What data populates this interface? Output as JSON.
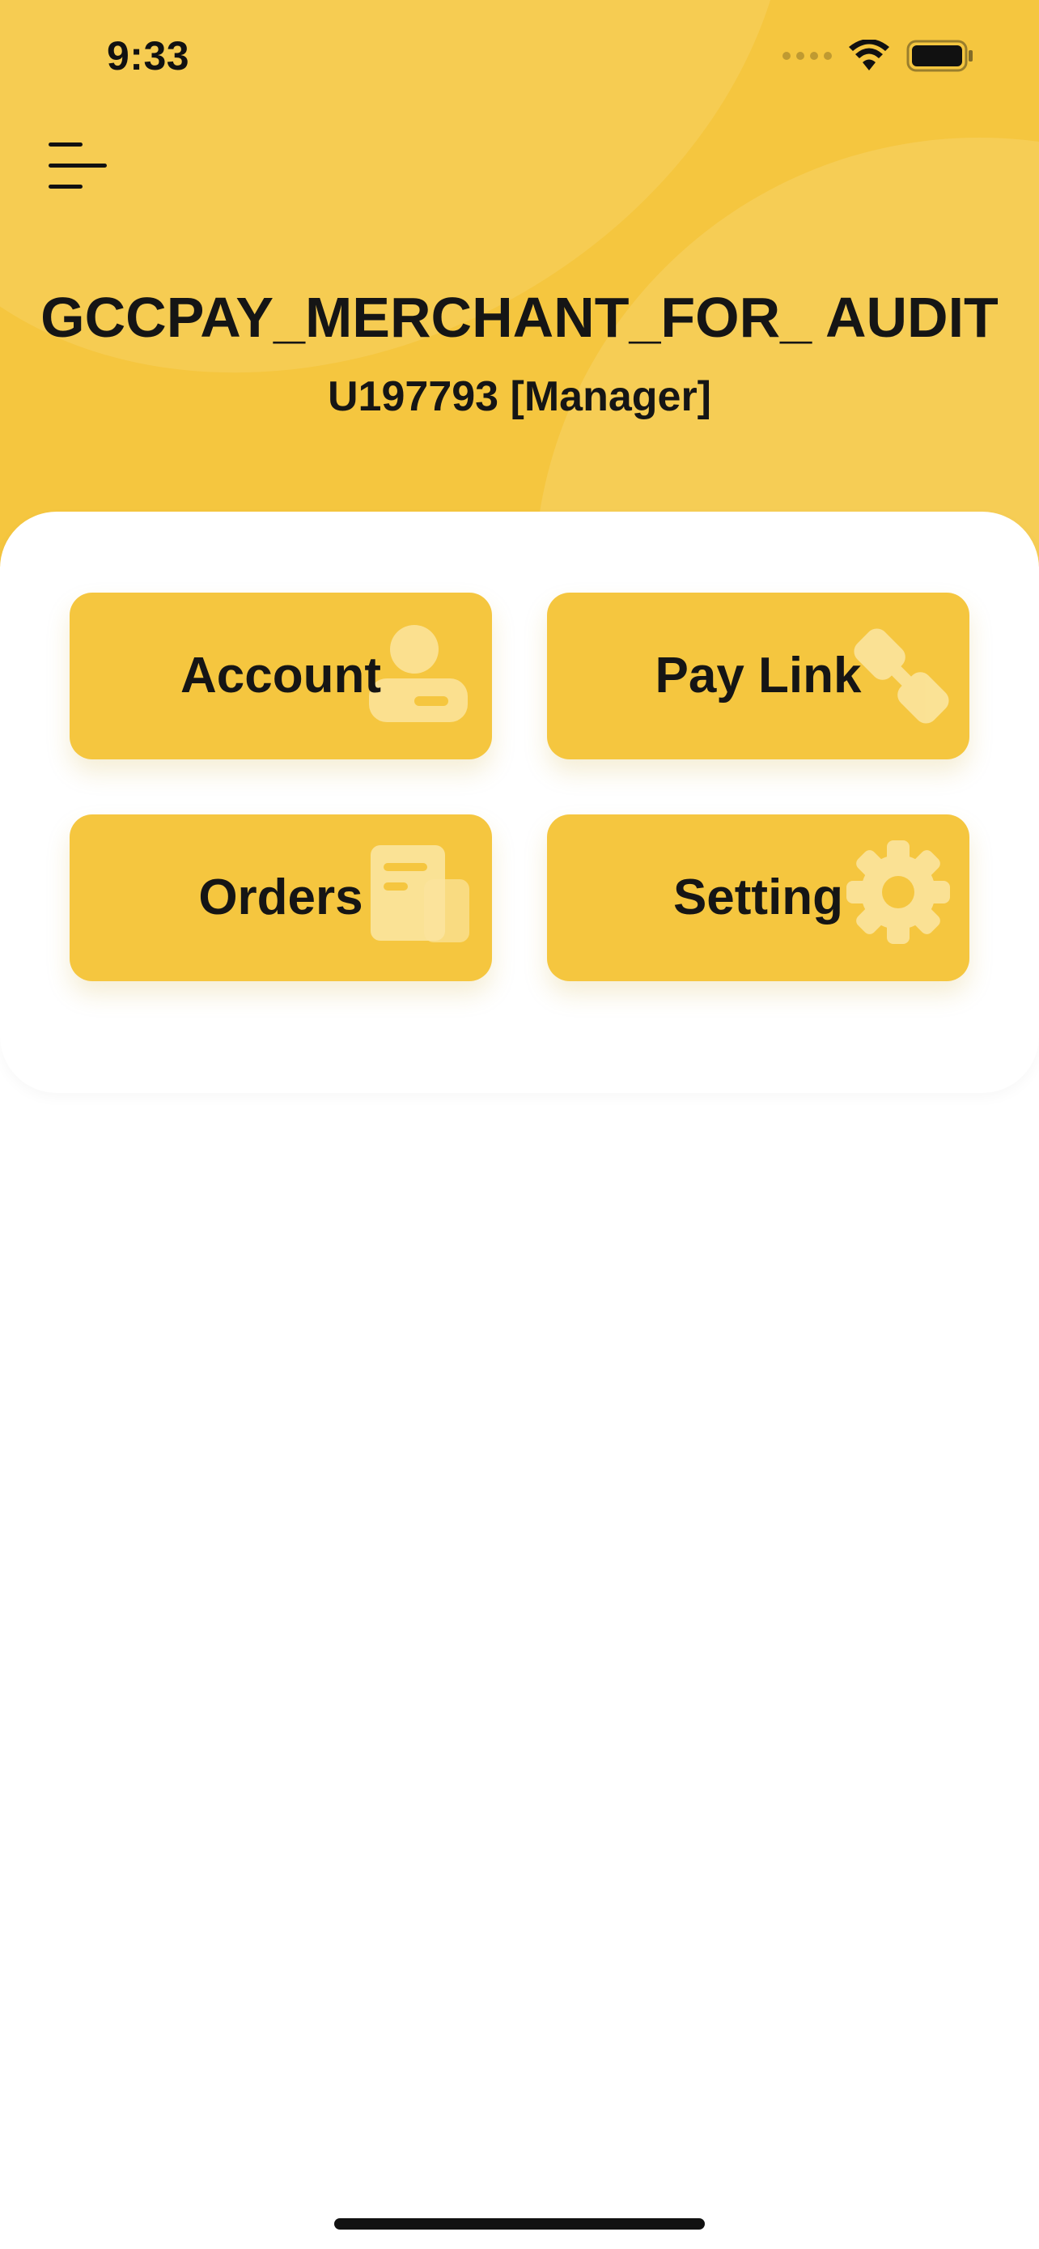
{
  "status_bar": {
    "time": "9:33"
  },
  "header": {
    "menu_icon": "menu-icon",
    "merchant_name": "GCCPAY_MERCHANT_FOR_ AUDIT",
    "user_line": "U197793 [Manager]"
  },
  "tiles": [
    {
      "label": "Account",
      "icon": "account-icon"
    },
    {
      "label": "Pay Link",
      "icon": "link-icon"
    },
    {
      "label": "Orders",
      "icon": "receipt-icon"
    },
    {
      "label": "Setting",
      "icon": "gear-icon"
    }
  ],
  "colors": {
    "accent": "#F5C63F",
    "text": "#151515",
    "background": "#FFFFFF"
  }
}
